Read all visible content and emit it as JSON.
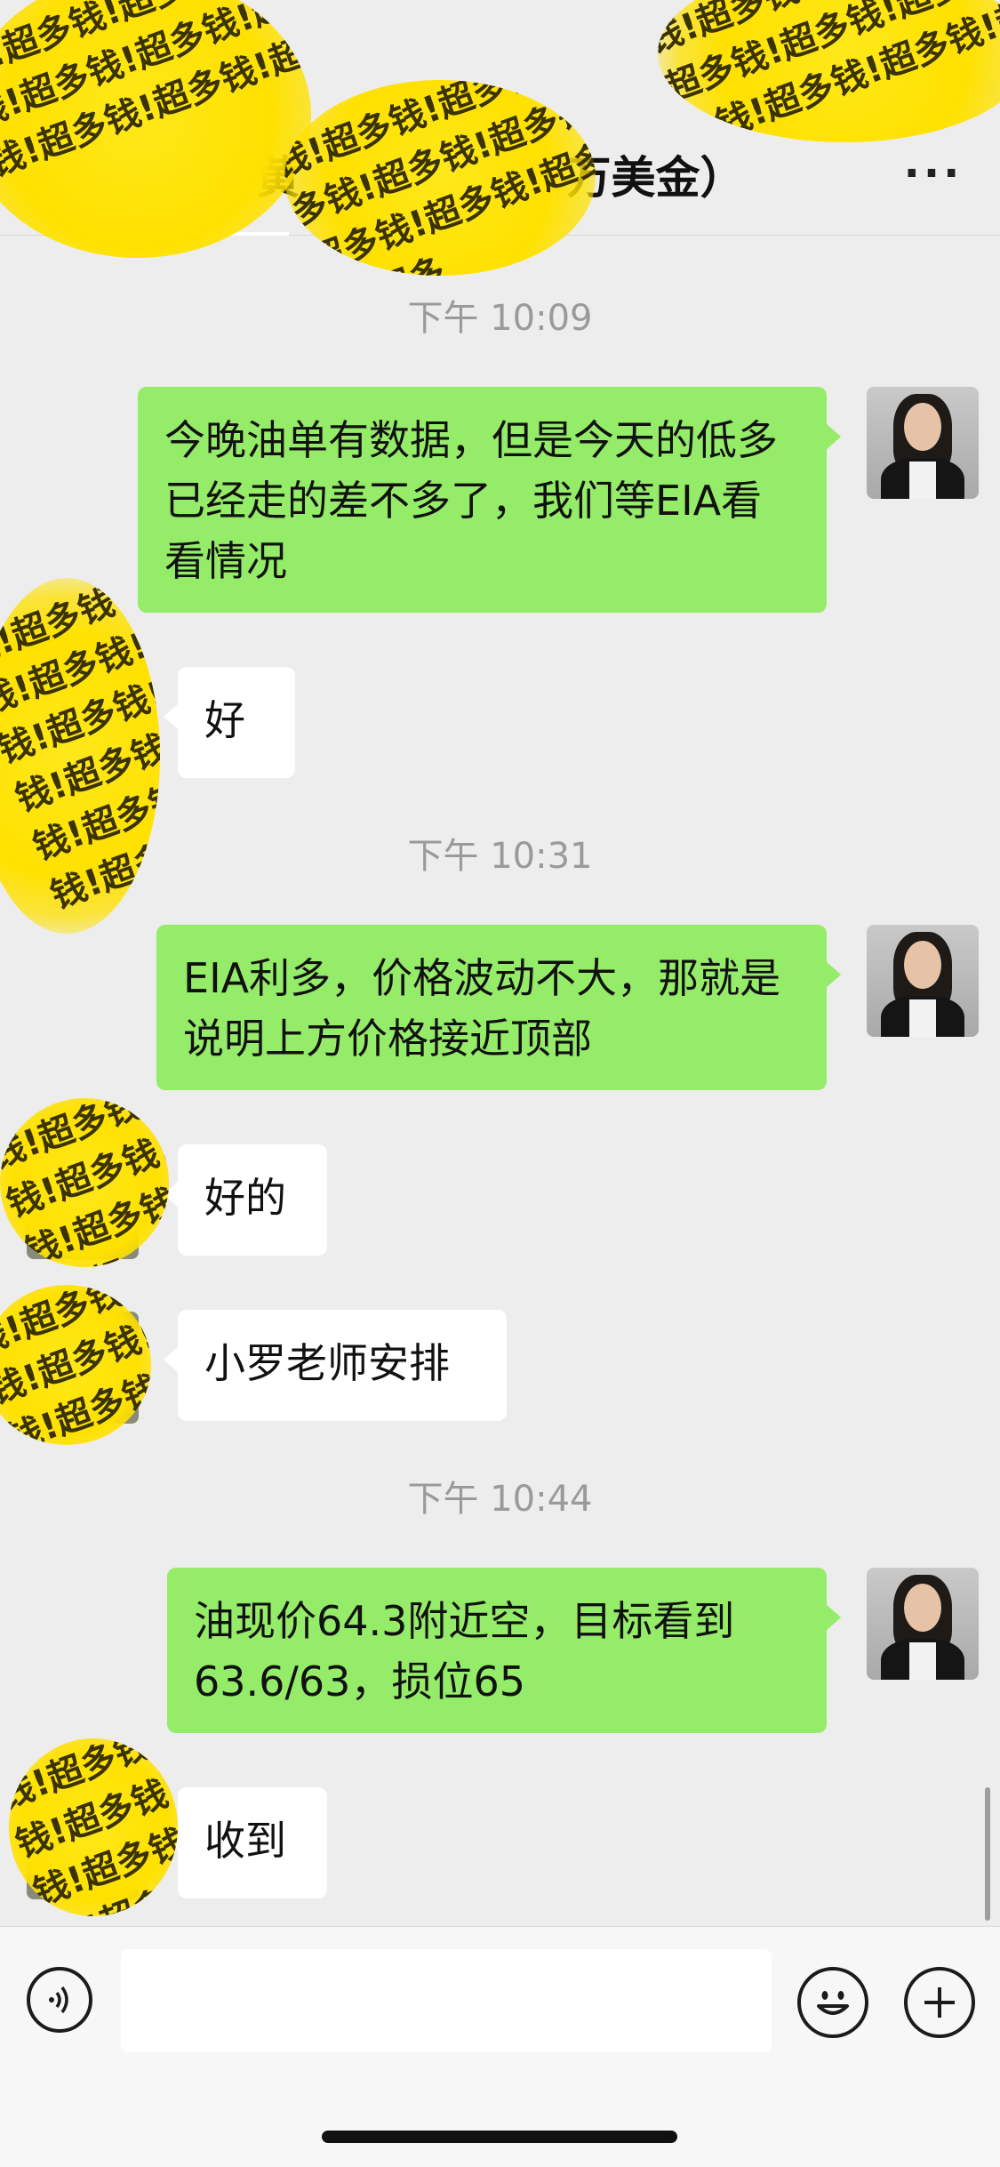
{
  "header": {
    "title": "黄　　　　　　万美金）",
    "more_label": "···"
  },
  "stickers": {
    "text": "钱!超多钱!超多钱!超多钱!超多钱!超多钱!超多钱!超多钱!超多钱!超多钱!超多钱!超多钱!超多"
  },
  "messages": [
    {
      "kind": "time",
      "text": "下午 10:09"
    },
    {
      "kind": "me",
      "text": "今晚油单有数据，但是今天的低多已经走的差不多了，我们等EIA看看情况"
    },
    {
      "kind": "other",
      "text": "好"
    },
    {
      "kind": "time",
      "text": "下午 10:31"
    },
    {
      "kind": "me",
      "text": "EIA利多，价格波动不大，那就是说明上方价格接近顶部"
    },
    {
      "kind": "other",
      "text": "好的"
    },
    {
      "kind": "other",
      "text": "小罗老师安排"
    },
    {
      "kind": "time",
      "text": "下午 10:44"
    },
    {
      "kind": "me",
      "text": "油现价64.3附近空，目标看到63.6/63，损位65"
    },
    {
      "kind": "other",
      "text": "收到"
    }
  ],
  "input": {
    "value": "",
    "placeholder": ""
  },
  "icons": {
    "voice": "voice-icon",
    "emoji": "emoji-icon",
    "plus": "plus-icon",
    "more": "more-icon"
  }
}
